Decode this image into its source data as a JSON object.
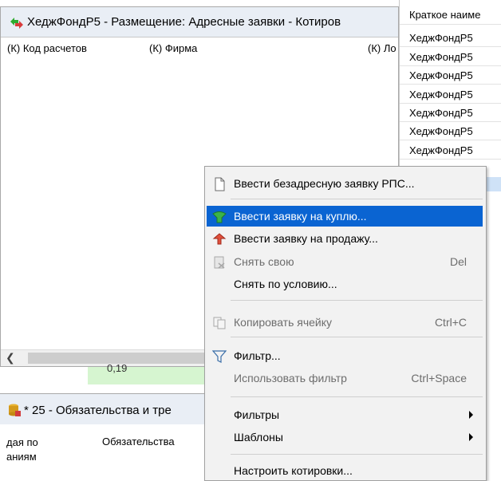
{
  "left_window": {
    "title": "ХеджФондР5 - Размещение: Адресные заявки - Котиров",
    "columns": [
      "(К) Код расчетов",
      "(К) Фирма",
      "(К) Ло"
    ]
  },
  "right_list": {
    "header": "Краткое наиме",
    "items": [
      "ХеджФондР5",
      "ХеджФондР5",
      "ХеджФондР5",
      "ХеджФондР5",
      "ХеджФондР5",
      "ХеджФондР5",
      "ХеджФондР5"
    ]
  },
  "strip": {
    "value": "0,19"
  },
  "lower_window": {
    "title": "* 25 - Обязательства и тре",
    "col1_line1": "дая по",
    "col1_line2": "аниям",
    "col2": "Обязательства"
  },
  "context_menu": {
    "items": [
      {
        "label": "Ввести безадресную заявку РПС...",
        "shortcut": "",
        "icon": "document-icon",
        "state": "normal"
      },
      {
        "label": "Ввести заявку на куплю...",
        "shortcut": "",
        "icon": "buy-icon",
        "state": "highlighted"
      },
      {
        "label": "Ввести заявку на продажу...",
        "shortcut": "",
        "icon": "sell-icon",
        "state": "normal"
      },
      {
        "label": "Снять свою",
        "shortcut": "Del",
        "icon": "cancel-order-icon",
        "state": "disabled"
      },
      {
        "label": "Снять по условию...",
        "shortcut": "",
        "icon": "",
        "state": "normal"
      },
      {
        "label": "Копировать ячейку",
        "shortcut": "Ctrl+C",
        "icon": "copy-icon",
        "state": "disabled"
      },
      {
        "label": "Фильтр...",
        "shortcut": "",
        "icon": "filter-icon",
        "state": "normal"
      },
      {
        "label": "Использовать фильтр",
        "shortcut": "Ctrl+Space",
        "icon": "",
        "state": "disabled"
      },
      {
        "label": "Фильтры",
        "shortcut": "",
        "icon": "",
        "state": "submenu"
      },
      {
        "label": "Шаблоны",
        "shortcut": "",
        "icon": "",
        "state": "submenu"
      },
      {
        "label": "Настроить котировки...",
        "shortcut": "",
        "icon": "",
        "state": "normal"
      }
    ]
  },
  "colors": {
    "highlight": "#0a64d2",
    "green_cell": "#d6f5d0"
  }
}
